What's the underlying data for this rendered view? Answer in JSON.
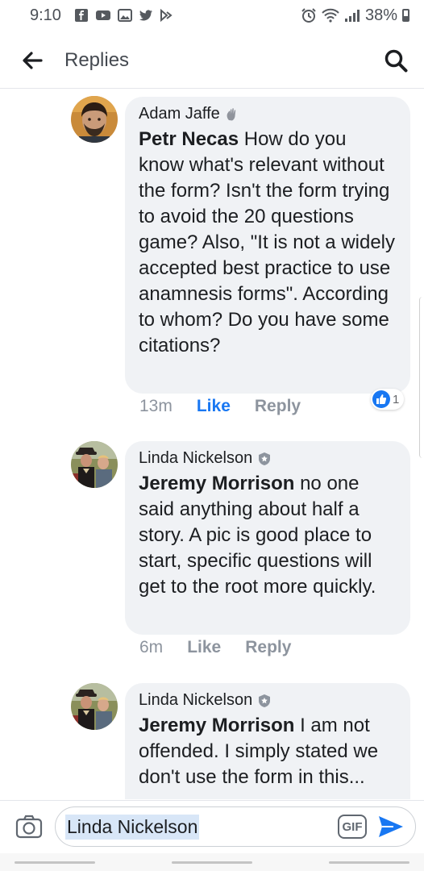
{
  "status_bar": {
    "time": "9:10",
    "battery": "38%"
  },
  "header": {
    "back_icon": "arrow-left-icon",
    "title": "Replies",
    "search_icon": "search-icon"
  },
  "comments": [
    {
      "author": "Adam Jaffe",
      "badge_icon": "waving-hand-icon",
      "mention": "Petr Necas",
      "text": "How do you know what's relevant without the form?  Isn't the form trying to avoid the 20 questions game?  Also, \"It is not a widely accepted best practice to use anamnesis forms\".  According to whom?  Do you have some citations?",
      "time": "13m",
      "like_label": "Like",
      "reply_label": "Reply",
      "like_active": true,
      "reaction_count": "1"
    },
    {
      "author": "Linda Nickelson",
      "badge_icon": "shield-badge-icon",
      "mention": "Jeremy Morrison",
      "text": "no one said anything about half a story. A pic is good place to start, specific questions will get to the root more quickly.",
      "time": "6m",
      "like_label": "Like",
      "reply_label": "Reply"
    },
    {
      "author": "Linda Nickelson",
      "badge_icon": "shield-badge-icon",
      "mention": "Jeremy Morrison",
      "text": "I am not offended. I simply stated we don't use the form in this..."
    }
  ],
  "composer": {
    "camera_icon": "camera-icon",
    "input_value": "Linda Nickelson",
    "gif_label": "GIF",
    "send_icon": "send-icon"
  },
  "colors": {
    "accent": "#1877f2",
    "bubble": "#f0f2f5",
    "muted": "#8d949e"
  }
}
